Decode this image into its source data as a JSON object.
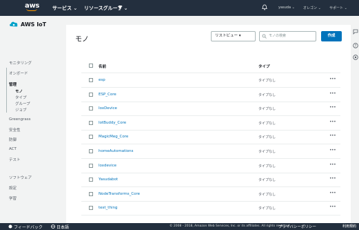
{
  "topnav": {
    "logo": "aws",
    "services": "サービス ⌄",
    "resource_groups": "リソースグループ ⌄",
    "user": "yasuda ⌄",
    "region": "オレゴン ⌄",
    "support": "サポート ⌄"
  },
  "sidebar": {
    "brand": "AWS IoT",
    "items": [
      {
        "label": "モニタリング"
      },
      {
        "label": "オンボード"
      },
      {
        "label": "管理"
      },
      {
        "label": "モノ"
      },
      {
        "label": "タイプ"
      },
      {
        "label": "グループ"
      },
      {
        "label": "ジョブ"
      },
      {
        "label": "Greengrass"
      },
      {
        "label": "安全性"
      },
      {
        "label": "防御"
      },
      {
        "label": "ACT"
      },
      {
        "label": "テスト"
      },
      {
        "label": "ソフトウェア"
      },
      {
        "label": "設定"
      },
      {
        "label": "学習"
      }
    ]
  },
  "main": {
    "title": "モノ",
    "list_view_label": "リストビュー ▾",
    "search_placeholder": "モノの検索",
    "create_label": "作成",
    "table": {
      "header_name": "名前",
      "header_type": "タイプ",
      "rows": [
        {
          "name": "esp",
          "type": "タイプなし",
          "actions": "•••"
        },
        {
          "name": "ESP_Core",
          "type": "タイプなし",
          "actions": "•••"
        },
        {
          "name": "IoxDevice",
          "type": "タイプなし",
          "actions": "•••"
        },
        {
          "name": "IotBuddy_Core",
          "type": "タイプなし",
          "actions": "•••"
        },
        {
          "name": "MagicMeg_Core",
          "type": "タイプなし",
          "actions": "•••"
        },
        {
          "name": "homeAutomations",
          "type": "タイプなし",
          "actions": "•••"
        },
        {
          "name": "loxdevice",
          "type": "タイプなし",
          "actions": "•••"
        },
        {
          "name": "Yasudabot",
          "type": "タイプなし",
          "actions": "•••"
        },
        {
          "name": "NodeTransforms_Core",
          "type": "タイプなし",
          "actions": "•••"
        },
        {
          "name": "test_thing",
          "type": "タイプなし",
          "actions": "•••"
        }
      ]
    }
  },
  "footer": {
    "feedback": "フィードバック",
    "language": "日本語",
    "copyright": "© 2008 - 2018, Amazon Web Services, Inc. or its affiliates. All rights reserved.",
    "privacy": "プライバシーポリシー",
    "terms": "利用規約"
  },
  "colors": {
    "nav_bg": "#232f3e",
    "accent": "#ff9900",
    "link": "#0073bb",
    "primary_button": "#0073bb"
  }
}
